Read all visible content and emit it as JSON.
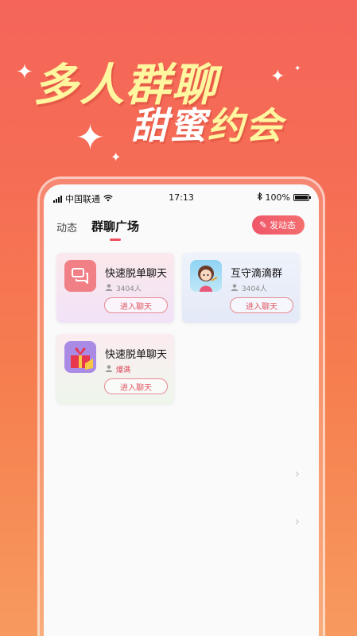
{
  "promo": {
    "line1": "多人群聊",
    "line2_a": "甜蜜",
    "line2_b": "约会"
  },
  "status_bar": {
    "carrier": "中国联通",
    "time": "17:13",
    "battery": "100%"
  },
  "tabs": [
    {
      "label": "动态",
      "active": false
    },
    {
      "label": "群聊广场",
      "active": true
    }
  ],
  "post_button": {
    "label": "发动态"
  },
  "groups": [
    {
      "name": "快速脱单聊天",
      "meta": "3404人",
      "button": "进入聊天",
      "avatar_icon": "chat-bubbles-icon"
    },
    {
      "name": "互守滴滴群",
      "meta": "3404人",
      "button": "进入聊天",
      "avatar_icon": "cartoon-girl-icon"
    },
    {
      "name": "快速脱单聊天",
      "meta": "爆满",
      "button": "进入聊天",
      "avatar_icon": "gift-box-icon"
    }
  ],
  "colors": {
    "accent": "#ee4f5c",
    "background_top": "#f5655a",
    "background_bottom": "#f79a5f",
    "headline_yellow": "#fff6a0"
  }
}
